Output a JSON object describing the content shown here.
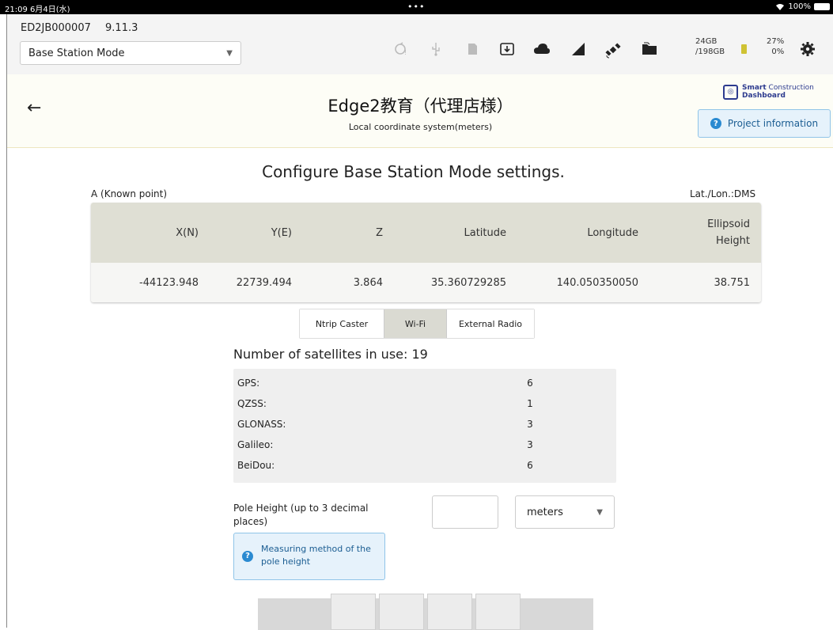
{
  "status": {
    "time": "21:09  6月4日(水)",
    "dots": "•••",
    "wifi_icon": "wifi-icon",
    "battery": "100%"
  },
  "topbar": {
    "device_id": "ED2JB000007",
    "version": "9.11.3",
    "mode_selected": "Base Station Mode",
    "storage_used": "24GB",
    "storage_total": "/198GB",
    "battery_pct_1": "27%",
    "battery_pct_2": "0%",
    "icons": [
      "sync-warning-icon",
      "usb-icon",
      "sd-card-icon",
      "download-icon",
      "cloud-icon",
      "signal-icon",
      "satellite-icon",
      "folder-icon",
      "battery-icon",
      "gear-icon"
    ]
  },
  "header": {
    "title": "Edge2教育（代理店様）",
    "subtitle": "Local coordinate system(meters)",
    "logo_line1_bold": "Smart",
    "logo_line1_rest": " Construction",
    "logo_line2": "Dashboard",
    "project_info_label": "Project information"
  },
  "main": {
    "heading": "Configure Base Station Mode settings.",
    "known_point_label": "A (Known point)",
    "latlon_format": "Lat./Lon.:DMS",
    "table": {
      "headers": [
        "X(N)",
        "Y(E)",
        "Z",
        "Latitude",
        "Longitude",
        "Ellipsoid Height"
      ],
      "row": [
        "-44123.948",
        "22739.494",
        "3.864",
        "35.360729285",
        "140.050350050",
        "38.751"
      ]
    },
    "tabs": [
      {
        "label": "Ntrip Caster",
        "selected": false
      },
      {
        "label": "Wi-Fi",
        "selected": true
      },
      {
        "label": "External Radio",
        "selected": false
      }
    ],
    "satellites_label": "Number of satellites in use: 19",
    "satellites": [
      {
        "name": "GPS:",
        "count": "6"
      },
      {
        "name": "QZSS:",
        "count": "1"
      },
      {
        "name": "GLONASS:",
        "count": "3"
      },
      {
        "name": "Galileo:",
        "count": "3"
      },
      {
        "name": "BeiDou:",
        "count": "6"
      }
    ],
    "pole_height_label": "Pole Height (up to 3 decimal places)",
    "pole_height_value": "",
    "unit_selected": "meters",
    "measuring_button": "Measuring method of the pole height"
  },
  "colors": {
    "accent_blue": "#2a8ad1",
    "header_bg": "#fdfdf6",
    "table_head_bg": "#dfdfd4",
    "selected_tab": "#dadad2"
  }
}
